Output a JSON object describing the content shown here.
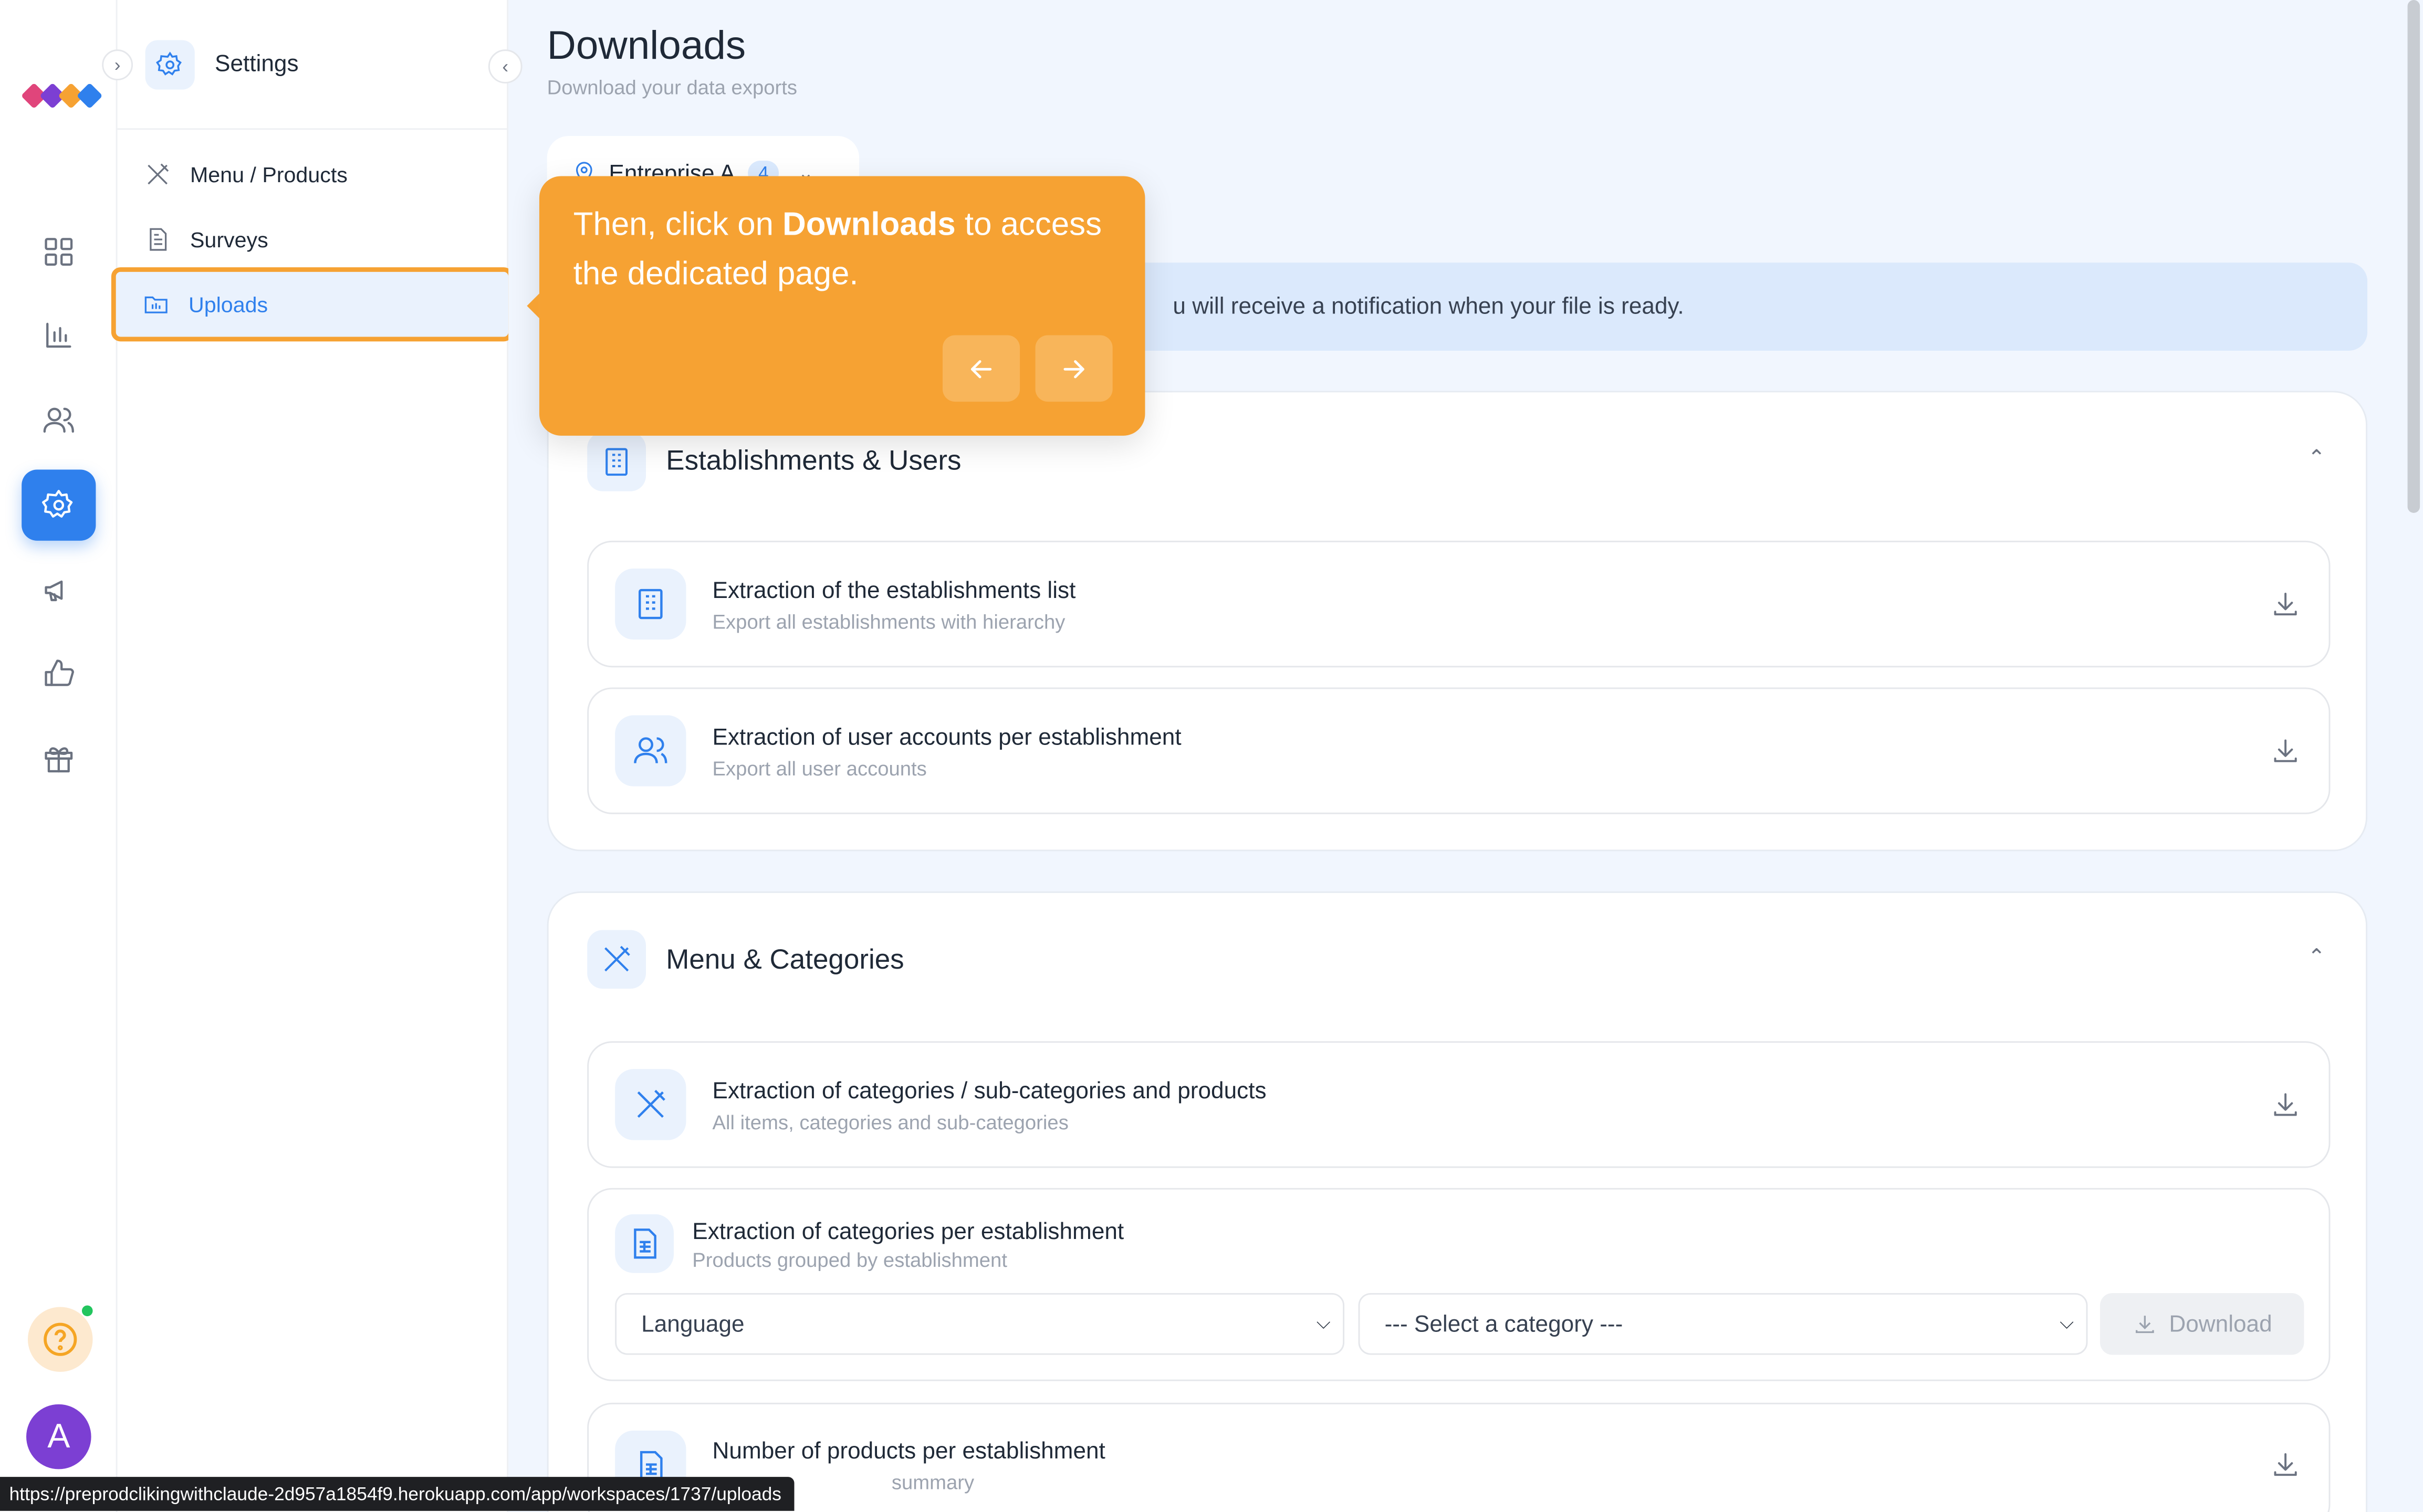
{
  "settings_panel": {
    "title": "Settings",
    "items": [
      {
        "label": "Menu / Products"
      },
      {
        "label": "Surveys"
      },
      {
        "label": "Uploads"
      }
    ]
  },
  "avatar_letter": "A",
  "header": {
    "title": "Downloads",
    "subtitle": "Download your data exports"
  },
  "enterprise": {
    "name": "Entreprise A",
    "count": "4"
  },
  "banner_text": "u will receive a notification when your file is ready.",
  "tooltip": {
    "before": "Then, click on ",
    "bold": "Downloads",
    "after": " to access the dedicated page."
  },
  "sections": [
    {
      "title": "Establishments & Users",
      "cards": [
        {
          "title": "Extraction of the establishments list",
          "subtitle": "Export all establishments with hierarchy"
        },
        {
          "title": "Extraction of user accounts per establishment",
          "subtitle": "Export all user accounts"
        }
      ]
    },
    {
      "title": "Menu & Categories",
      "cards": [
        {
          "title": "Extraction of categories / sub-categories and products",
          "subtitle": "All items, categories and sub-categories"
        },
        {
          "title": "Extraction of categories per establishment",
          "subtitle": "Products grouped by establishment",
          "language_select": "Language",
          "category_select": "--- Select a category ---",
          "download_label": "Download"
        },
        {
          "title": "Number of products per establishment",
          "subtitle": "summary"
        }
      ]
    }
  ],
  "status_url": "https://preprodclikingwithclaude-2d957a1854f9.herokuapp.com/app/workspaces/1737/uploads",
  "colors": {
    "accent": "#2f80ed",
    "tooltip": "#f6a233",
    "background": "#f1f6fe"
  }
}
